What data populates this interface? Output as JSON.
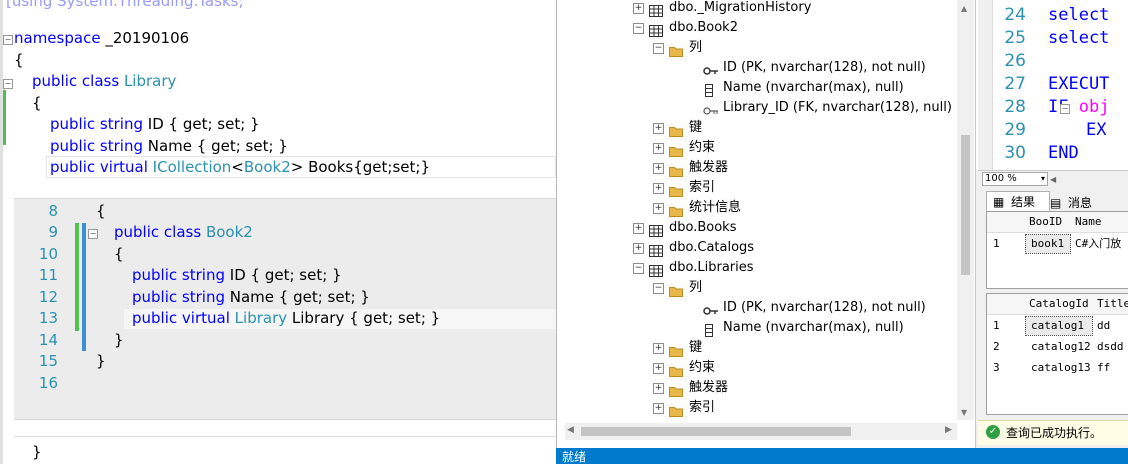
{
  "editor": {
    "top_cut": "[using System.Threading.Tasks;",
    "namespace_kw": "namespace",
    "namespace_name": "_20190106",
    "brace_open": "{",
    "brace_close": "}",
    "kw_public": "public",
    "kw_class": "class",
    "kw_string": "string",
    "kw_virtual": "virtual",
    "class1": "Library",
    "id_prop": "ID { get; set; }",
    "name_prop": "Name { get; set; }",
    "icollection": "ICollection",
    "lt": "<",
    "book2_type": "Book2",
    "books_rest": "> Books{get;set;}",
    "peek": {
      "line_numbers": [
        "8",
        "9",
        "10",
        "11",
        "12",
        "13",
        "14",
        "15",
        "16"
      ],
      "class2": "Book2",
      "library_type": "Library",
      "library_prop": "Library { get; set; }"
    }
  },
  "explorer": {
    "nodes": [
      {
        "label": "dbo._MigrationHistory",
        "icon": "table-icon"
      },
      {
        "label": "dbo.Book2",
        "icon": "table-icon"
      },
      {
        "label": "列",
        "icon": "folder-icon"
      },
      {
        "label": "ID (PK, nvarchar(128), not null)",
        "icon": "primary-key-icon"
      },
      {
        "label": "Name (nvarchar(max), null)",
        "icon": "column-icon"
      },
      {
        "label": "Library_ID (FK, nvarchar(128), null)",
        "icon": "foreign-key-icon"
      },
      {
        "label": "键",
        "icon": "folder-icon"
      },
      {
        "label": "约束",
        "icon": "folder-icon"
      },
      {
        "label": "触发器",
        "icon": "folder-icon"
      },
      {
        "label": "索引",
        "icon": "folder-icon"
      },
      {
        "label": "统计信息",
        "icon": "folder-icon"
      },
      {
        "label": "dbo.Books",
        "icon": "table-icon"
      },
      {
        "label": "dbo.Catalogs",
        "icon": "table-icon"
      },
      {
        "label": "dbo.Libraries",
        "icon": "table-icon"
      },
      {
        "label": "列",
        "icon": "folder-icon"
      },
      {
        "label": "ID (PK, nvarchar(128), not null)",
        "icon": "primary-key-icon"
      },
      {
        "label": "Name (nvarchar(max), null)",
        "icon": "column-icon"
      },
      {
        "label": "键",
        "icon": "folder-icon"
      },
      {
        "label": "约束",
        "icon": "folder-icon"
      },
      {
        "label": "触发器",
        "icon": "folder-icon"
      },
      {
        "label": "索引",
        "icon": "folder-icon"
      }
    ],
    "status": "就绪"
  },
  "sql": {
    "line_numbers": [
      "24",
      "25",
      "26",
      "27",
      "28",
      "29",
      "30"
    ],
    "lines": [
      "select",
      "select",
      "",
      "EXECUT",
      "IF obj",
      "EX",
      "END"
    ],
    "zoom": "100 %"
  },
  "results": {
    "tab_results": "结果",
    "tab_messages": "消息",
    "grid1": {
      "headers": [
        "BooID",
        "Name"
      ],
      "rows": [
        [
          "1",
          "book1",
          "C#入门放"
        ]
      ]
    },
    "grid2": {
      "headers": [
        "CatalogId",
        "Title"
      ],
      "rows": [
        [
          "1",
          "catalog1",
          "dd"
        ],
        [
          "2",
          "catalog12",
          "dsdd"
        ],
        [
          "3",
          "catalog13",
          "ff"
        ]
      ]
    },
    "status": "查询已成功执行。"
  },
  "colors": {
    "accent": "#007acc",
    "keyword": "#0000ff",
    "type": "#2b91af",
    "success": "#2ea043"
  }
}
